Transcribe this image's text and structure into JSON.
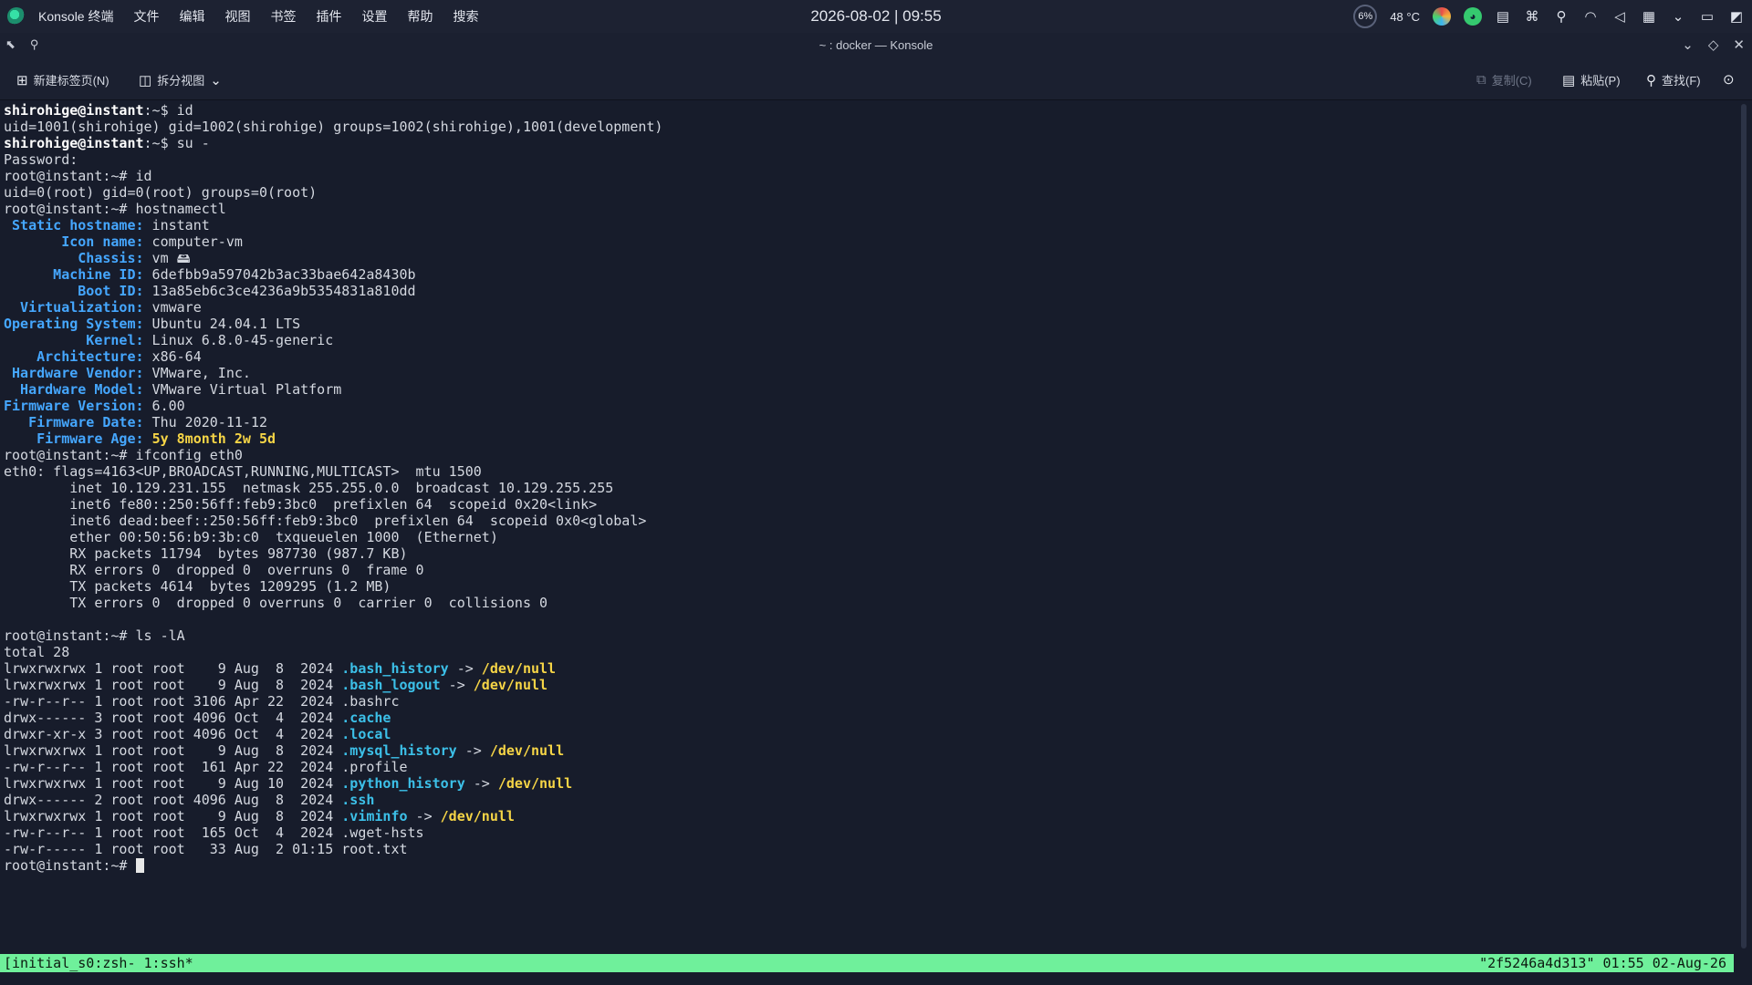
{
  "panel": {
    "app_name": "Konsole 终端",
    "menu": [
      "文件",
      "编辑",
      "视图",
      "书签",
      "插件",
      "设置",
      "帮助",
      "搜索"
    ],
    "clock": "2026-08-02 | 09:55",
    "cpu": "6%",
    "temp": "48 °C"
  },
  "window": {
    "title": "~ : docker — Konsole"
  },
  "toolbar": {
    "new_tab": "新建标签页(N)",
    "split_view": "拆分视图",
    "copy": "复制(C)",
    "paste": "粘贴(P)",
    "find": "查找(F)"
  },
  "terminal": {
    "lines": [
      [
        {
          "t": "shirohige@instant",
          "c": "c-w"
        },
        {
          "t": ":~$ id"
        }
      ],
      [
        {
          "t": "uid=1001(shirohige) gid=1002(shirohige) groups=1002(shirohige),1001(development)"
        }
      ],
      [
        {
          "t": "shirohige@instant",
          "c": "c-w"
        },
        {
          "t": ":~$ su -"
        }
      ],
      [
        {
          "t": "Password:"
        }
      ],
      [
        {
          "t": "root@instant:~# id"
        }
      ],
      [
        {
          "t": "uid=0(root) gid=0(root) groups=0(root)"
        }
      ],
      [
        {
          "t": "root@instant:~# hostnamectl"
        }
      ],
      [
        {
          "t": " Static hostname:",
          "c": "c-b"
        },
        {
          "t": " instant"
        }
      ],
      [
        {
          "t": "       Icon name:",
          "c": "c-b"
        },
        {
          "t": " computer-vm"
        }
      ],
      [
        {
          "t": "         Chassis:",
          "c": "c-b"
        },
        {
          "t": " vm 🖴"
        }
      ],
      [
        {
          "t": "      Machine ID:",
          "c": "c-b"
        },
        {
          "t": " 6defbb9a597042b3ac33bae642a8430b"
        }
      ],
      [
        {
          "t": "         Boot ID:",
          "c": "c-b"
        },
        {
          "t": " 13a85eb6c3ce4236a9b5354831a810dd"
        }
      ],
      [
        {
          "t": "  Virtualization:",
          "c": "c-b"
        },
        {
          "t": " vmware"
        }
      ],
      [
        {
          "t": "Operating System:",
          "c": "c-b"
        },
        {
          "t": " Ubuntu 24.04.1 LTS"
        }
      ],
      [
        {
          "t": "          Kernel:",
          "c": "c-b"
        },
        {
          "t": " Linux 6.8.0-45-generic"
        }
      ],
      [
        {
          "t": "    Architecture:",
          "c": "c-b"
        },
        {
          "t": " x86-64"
        }
      ],
      [
        {
          "t": " Hardware Vendor:",
          "c": "c-b"
        },
        {
          "t": " VMware, Inc."
        }
      ],
      [
        {
          "t": "  Hardware Model:",
          "c": "c-b"
        },
        {
          "t": " VMware Virtual Platform"
        }
      ],
      [
        {
          "t": "Firmware Version:",
          "c": "c-b"
        },
        {
          "t": " 6.00"
        }
      ],
      [
        {
          "t": "   Firmware Date:",
          "c": "c-b"
        },
        {
          "t": " Thu 2020-11-12"
        }
      ],
      [
        {
          "t": "    Firmware Age:",
          "c": "c-b"
        },
        {
          "t": " "
        },
        {
          "t": "5y 8month 2w 5d",
          "c": "c-y"
        }
      ],
      [
        {
          "t": "root@instant:~# ifconfig eth0"
        }
      ],
      [
        {
          "t": "eth0: flags=4163<UP,BROADCAST,RUNNING,MULTICAST>  mtu 1500"
        }
      ],
      [
        {
          "t": "        inet 10.129.231.155  netmask 255.255.0.0  broadcast 10.129.255.255"
        }
      ],
      [
        {
          "t": "        inet6 fe80::250:56ff:feb9:3bc0  prefixlen 64  scopeid 0x20<link>"
        }
      ],
      [
        {
          "t": "        inet6 dead:beef::250:56ff:feb9:3bc0  prefixlen 64  scopeid 0x0<global>"
        }
      ],
      [
        {
          "t": "        ether 00:50:56:b9:3b:c0  txqueuelen 1000  (Ethernet)"
        }
      ],
      [
        {
          "t": "        RX packets 11794  bytes 987730 (987.7 KB)"
        }
      ],
      [
        {
          "t": "        RX errors 0  dropped 0  overruns 0  frame 0"
        }
      ],
      [
        {
          "t": "        TX packets 4614  bytes 1209295 (1.2 MB)"
        }
      ],
      [
        {
          "t": "        TX errors 0  dropped 0 overruns 0  carrier 0  collisions 0"
        }
      ],
      [
        {
          "t": ""
        }
      ],
      [
        {
          "t": "root@instant:~# ls -lA"
        }
      ],
      [
        {
          "t": "total 28"
        }
      ],
      [
        {
          "t": "lrwxrwxrwx 1 root root    9 Aug  8  2024 "
        },
        {
          "t": ".bash_history",
          "c": "c-cy"
        },
        {
          "t": " -> "
        },
        {
          "t": "/dev/null",
          "c": "c-y"
        }
      ],
      [
        {
          "t": "lrwxrwxrwx 1 root root    9 Aug  8  2024 "
        },
        {
          "t": ".bash_logout",
          "c": "c-cy"
        },
        {
          "t": " -> "
        },
        {
          "t": "/dev/null",
          "c": "c-y"
        }
      ],
      [
        {
          "t": "-rw-r--r-- 1 root root 3106 Apr 22  2024 .bashrc"
        }
      ],
      [
        {
          "t": "drwx------ 3 root root 4096 Oct  4  2024 "
        },
        {
          "t": ".cache",
          "c": "c-cy"
        }
      ],
      [
        {
          "t": "drwxr-xr-x 3 root root 4096 Oct  4  2024 "
        },
        {
          "t": ".local",
          "c": "c-cy"
        }
      ],
      [
        {
          "t": "lrwxrwxrwx 1 root root    9 Aug  8  2024 "
        },
        {
          "t": ".mysql_history",
          "c": "c-cy"
        },
        {
          "t": " -> "
        },
        {
          "t": "/dev/null",
          "c": "c-y"
        }
      ],
      [
        {
          "t": "-rw-r--r-- 1 root root  161 Apr 22  2024 .profile"
        }
      ],
      [
        {
          "t": "lrwxrwxrwx 1 root root    9 Aug 10  2024 "
        },
        {
          "t": ".python_history",
          "c": "c-cy"
        },
        {
          "t": " -> "
        },
        {
          "t": "/dev/null",
          "c": "c-y"
        }
      ],
      [
        {
          "t": "drwx------ 2 root root 4096 Aug  8  2024 "
        },
        {
          "t": ".ssh",
          "c": "c-cy"
        }
      ],
      [
        {
          "t": "lrwxrwxrwx 1 root root    9 Aug  8  2024 "
        },
        {
          "t": ".viminfo",
          "c": "c-cy"
        },
        {
          "t": " -> "
        },
        {
          "t": "/dev/null",
          "c": "c-y"
        }
      ],
      [
        {
          "t": "-rw-r--r-- 1 root root  165 Oct  4  2024 .wget-hsts"
        }
      ],
      [
        {
          "t": "-rw-r----- 1 root root   33 Aug  2 01:15 root.txt"
        }
      ],
      [
        {
          "t": "root@instant:~# "
        },
        {
          "cursor": true
        }
      ]
    ]
  },
  "status": {
    "left": "[initial_s0:zsh- 1:ssh*",
    "right": "\"2f5246a4d313\" 01:55 02-Aug-26"
  }
}
